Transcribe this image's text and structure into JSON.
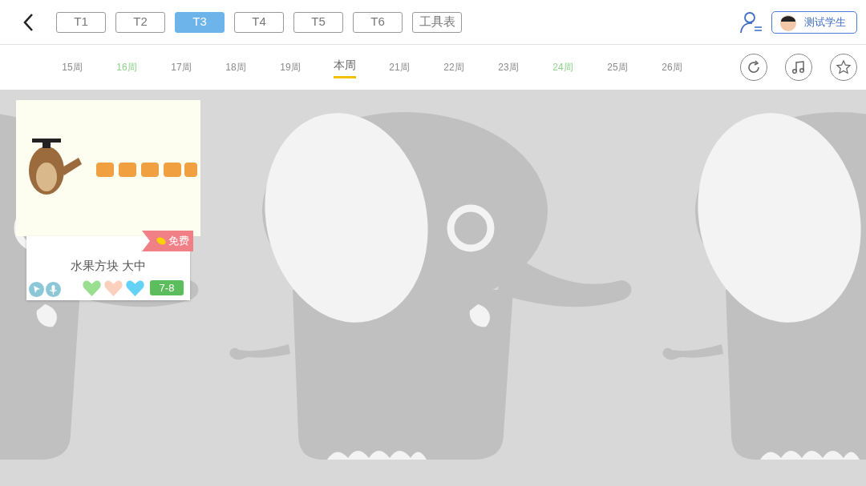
{
  "tabs": [
    {
      "label": "T1",
      "selected": false
    },
    {
      "label": "T2",
      "selected": false
    },
    {
      "label": "T3",
      "selected": true
    },
    {
      "label": "T4",
      "selected": false
    },
    {
      "label": "T5",
      "selected": false
    },
    {
      "label": "T6",
      "selected": false
    },
    {
      "label": "工具表",
      "selected": false
    }
  ],
  "user": {
    "name": "测试学生"
  },
  "weeks": [
    {
      "label": "15周",
      "selected": false,
      "color": "#8a8a8a"
    },
    {
      "label": "16周",
      "selected": false,
      "color": "#8fd18a"
    },
    {
      "label": "17周",
      "selected": false,
      "color": "#8a8a8a"
    },
    {
      "label": "18周",
      "selected": false,
      "color": "#8a8a8a"
    },
    {
      "label": "19周",
      "selected": false,
      "color": "#8a8a8a"
    },
    {
      "label": "本周",
      "selected": true,
      "color": "#666666"
    },
    {
      "label": "21周",
      "selected": false,
      "color": "#8a8a8a"
    },
    {
      "label": "22周",
      "selected": false,
      "color": "#8a8a8a"
    },
    {
      "label": "23周",
      "selected": false,
      "color": "#8a8a8a"
    },
    {
      "label": "24周",
      "selected": false,
      "color": "#8fd18a"
    },
    {
      "label": "25周",
      "selected": false,
      "color": "#8a8a8a"
    },
    {
      "label": "26周",
      "selected": false,
      "color": "#8a8a8a"
    }
  ],
  "cards": [
    {
      "badge": "免费",
      "title": "水果方块 大中",
      "hearts": [
        {
          "color": "#9adf8f"
        },
        {
          "color": "#fbd0bd"
        },
        {
          "color": "#63d2f5"
        }
      ],
      "age": "7-8"
    }
  ]
}
